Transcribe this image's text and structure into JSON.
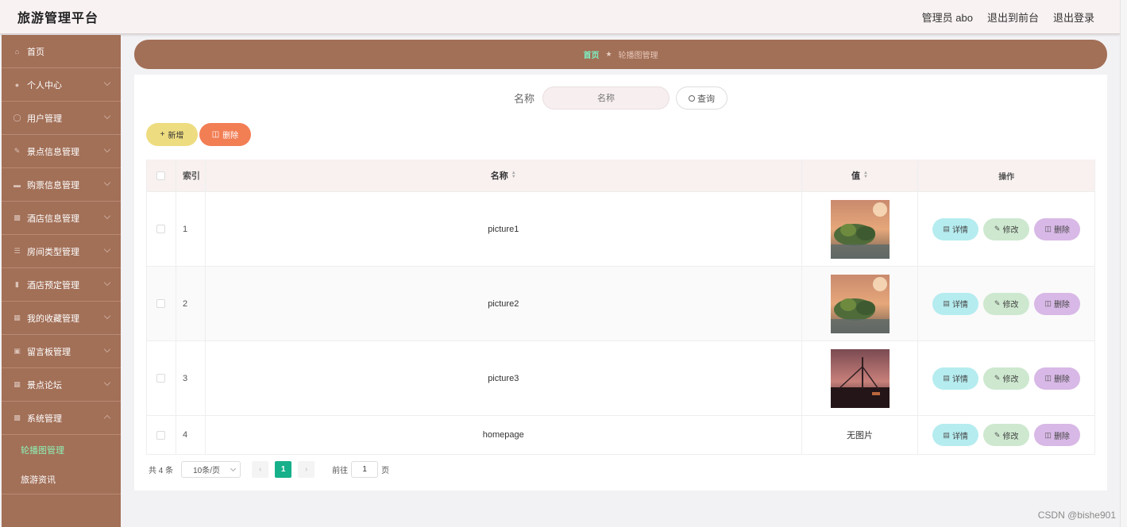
{
  "header": {
    "brand": "旅游管理平台",
    "user": "管理员 abo",
    "to_front": "退出到前台",
    "logout": "退出登录"
  },
  "sidebar": {
    "items": [
      {
        "label": "首页",
        "icon": "home-icon",
        "expandable": false
      },
      {
        "label": "个人中心",
        "icon": "user-icon",
        "expandable": true
      },
      {
        "label": "用户管理",
        "icon": "user-group-icon",
        "expandable": true
      },
      {
        "label": "景点信息管理",
        "icon": "scenic-icon",
        "expandable": true
      },
      {
        "label": "购票信息管理",
        "icon": "ticket-icon",
        "expandable": true
      },
      {
        "label": "酒店信息管理",
        "icon": "hotel-icon",
        "expandable": true
      },
      {
        "label": "房间类型管理",
        "icon": "list-icon",
        "expandable": true
      },
      {
        "label": "酒店预定管理",
        "icon": "chart-icon",
        "expandable": true
      },
      {
        "label": "我的收藏管理",
        "icon": "grid-icon",
        "expandable": true
      },
      {
        "label": "留言板管理",
        "icon": "message-icon",
        "expandable": true
      },
      {
        "label": "景点论坛",
        "icon": "forum-icon",
        "expandable": true
      },
      {
        "label": "系统管理",
        "icon": "system-icon",
        "expandable": true
      }
    ],
    "submenu": [
      "轮播图管理",
      "旅游资讯"
    ]
  },
  "breadcrumb": {
    "home": "首页",
    "current": "轮播图管理"
  },
  "search": {
    "label": "名称",
    "placeholder": "名称",
    "button": "查询"
  },
  "actions": {
    "add": "新增",
    "delete": "删除"
  },
  "table": {
    "headers": {
      "index": "索引",
      "name": "名称",
      "value": "值",
      "ops": "操作"
    },
    "rows": [
      {
        "index": "1",
        "name": "picture1",
        "value_type": "image",
        "value_text": ""
      },
      {
        "index": "2",
        "name": "picture2",
        "value_type": "image",
        "value_text": ""
      },
      {
        "index": "3",
        "name": "picture3",
        "value_type": "image",
        "value_text": ""
      },
      {
        "index": "4",
        "name": "homepage",
        "value_type": "text",
        "value_text": "无图片"
      }
    ],
    "op_labels": {
      "view": "详情",
      "edit": "修改",
      "remove": "删除"
    }
  },
  "pagination": {
    "total": "共 4 条",
    "page_size": "10条/页",
    "current_page": "1",
    "goto_prefix": "前往",
    "goto_value": "1",
    "goto_suffix": "页"
  },
  "watermark": "CSDN @bishe901",
  "colors": {
    "sidebar_bg": "#a26f57",
    "accent_green": "#16b08a",
    "add_btn": "#eedc80",
    "delete_btn": "#f27e54",
    "view_btn": "#b5ecef",
    "edit_btn": "#cde8cf",
    "remove_btn": "#d8b8e6"
  }
}
